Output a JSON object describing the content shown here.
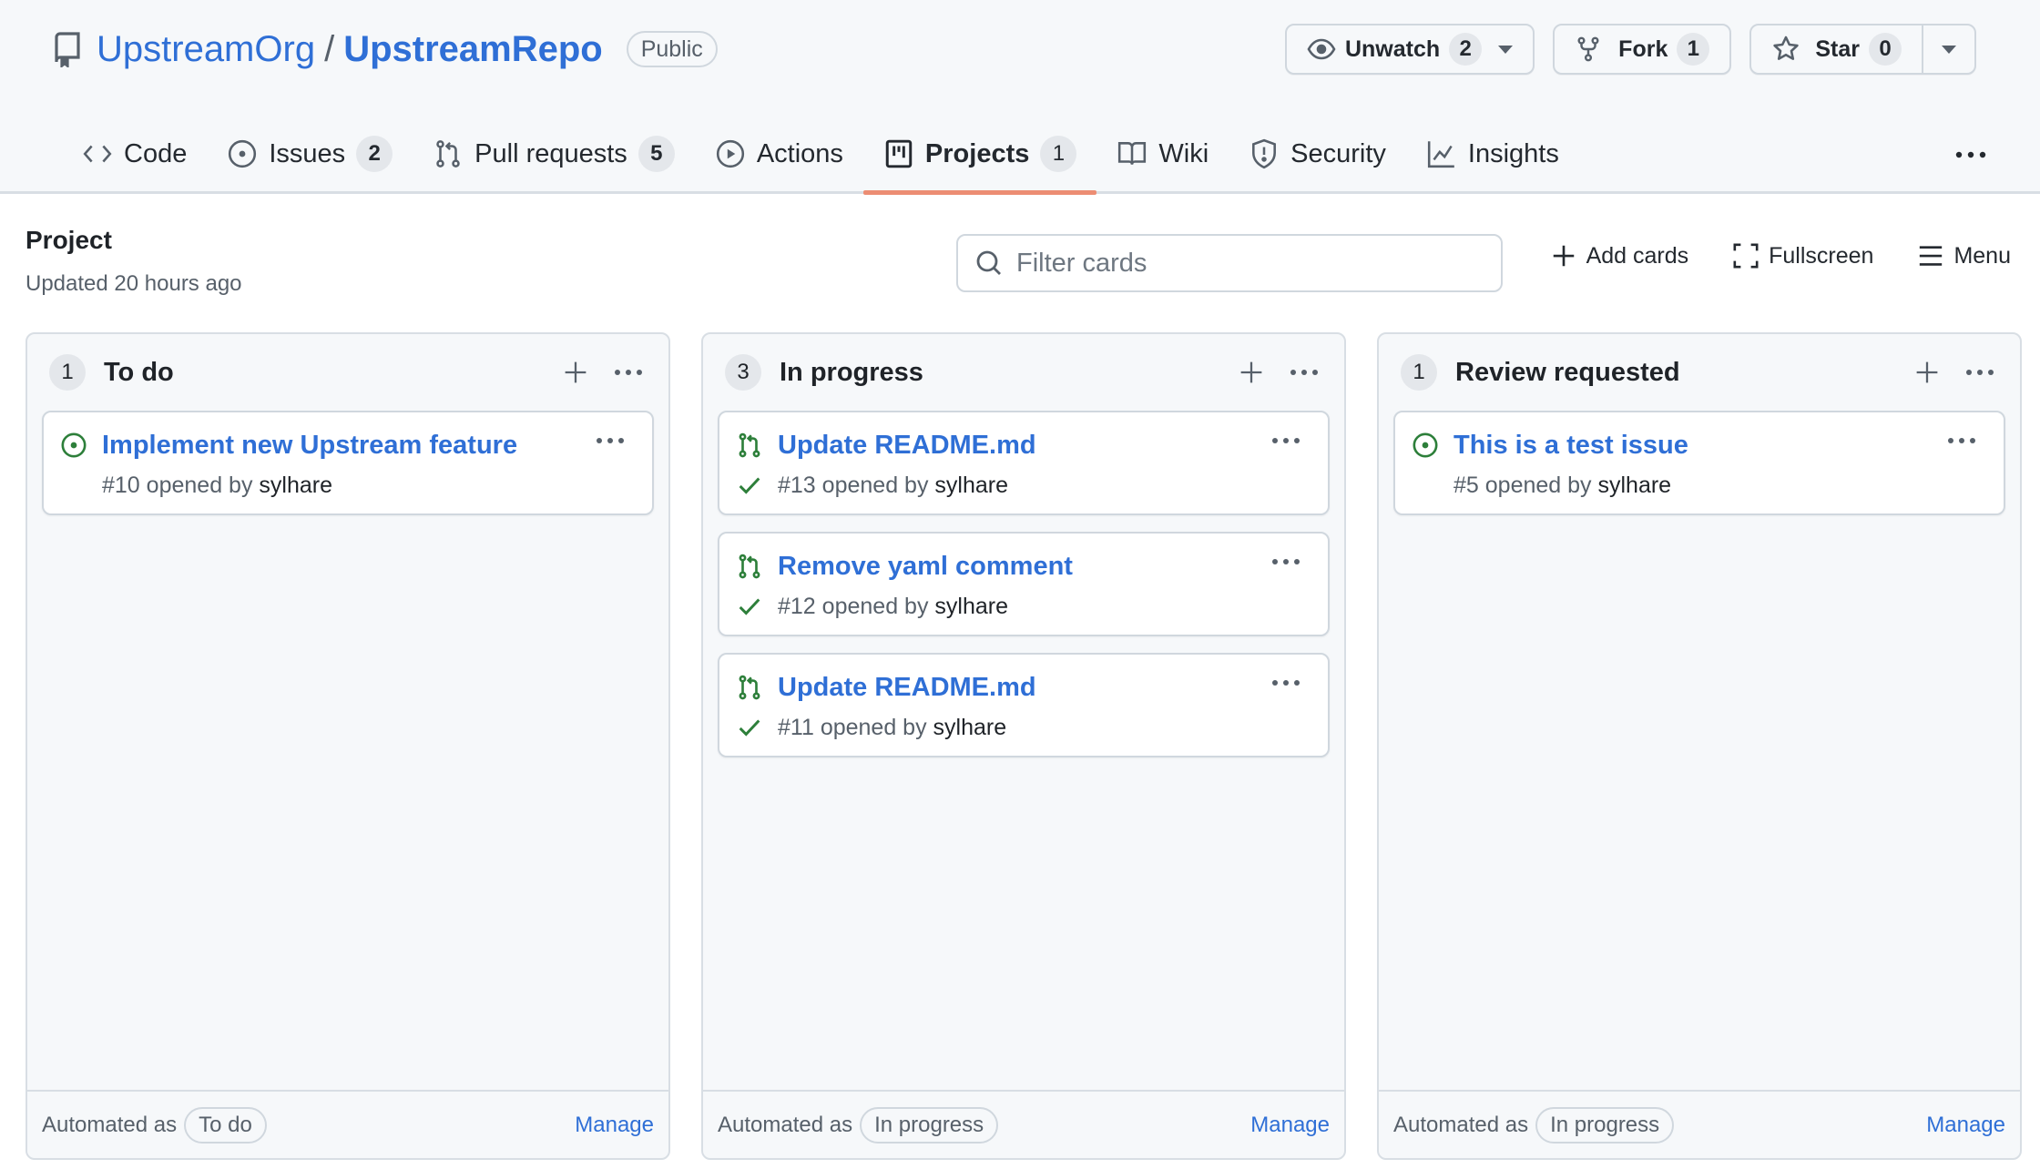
{
  "repo": {
    "owner": "UpstreamOrg",
    "separator": "/",
    "name": "UpstreamRepo",
    "visibility": "Public",
    "icon": "repo-icon"
  },
  "header_actions": {
    "watch": {
      "label": "Unwatch",
      "count": "2",
      "icon": "eye-icon"
    },
    "fork": {
      "label": "Fork",
      "count": "1",
      "icon": "repo-forked-icon"
    },
    "star": {
      "label": "Star",
      "count": "0",
      "icon": "star-icon"
    }
  },
  "tabs": [
    {
      "label": "Code",
      "icon": "code-icon",
      "count": null,
      "selected": false
    },
    {
      "label": "Issues",
      "icon": "issue-opened-icon",
      "count": "2",
      "selected": false
    },
    {
      "label": "Pull requests",
      "icon": "git-pull-request-icon",
      "count": "5",
      "selected": false
    },
    {
      "label": "Actions",
      "icon": "play-icon",
      "count": null,
      "selected": false
    },
    {
      "label": "Projects",
      "icon": "project-icon",
      "count": "1",
      "selected": true
    },
    {
      "label": "Wiki",
      "icon": "book-icon",
      "count": null,
      "selected": false
    },
    {
      "label": "Security",
      "icon": "shield-icon",
      "count": null,
      "selected": false
    },
    {
      "label": "Insights",
      "icon": "graph-icon",
      "count": null,
      "selected": false
    }
  ],
  "project": {
    "name": "Project",
    "updated": "Updated 20 hours ago"
  },
  "toolbar": {
    "filter_placeholder": "Filter cards",
    "filter_value": "",
    "add_cards": "Add cards",
    "fullscreen": "Fullscreen",
    "menu": "Menu"
  },
  "columns": [
    {
      "count": "1",
      "title": "To do",
      "automated_label": "Automated as",
      "automated_value": "To do",
      "manage": "Manage",
      "cards": [
        {
          "type": "issue",
          "title": "Implement new Upstream feature",
          "number": "#10",
          "opened_by": "opened by",
          "author": "sylhare",
          "checks_passed": false
        }
      ]
    },
    {
      "count": "3",
      "title": "In progress",
      "automated_label": "Automated as",
      "automated_value": "In progress",
      "manage": "Manage",
      "cards": [
        {
          "type": "pull-request",
          "title": "Update README.md",
          "number": "#13",
          "opened_by": "opened by",
          "author": "sylhare",
          "checks_passed": true
        },
        {
          "type": "pull-request",
          "title": "Remove yaml comment",
          "number": "#12",
          "opened_by": "opened by",
          "author": "sylhare",
          "checks_passed": true
        },
        {
          "type": "pull-request",
          "title": "Update README.md",
          "number": "#11",
          "opened_by": "opened by",
          "author": "sylhare",
          "checks_passed": true
        }
      ]
    },
    {
      "count": "1",
      "title": "Review requested",
      "automated_label": "Automated as",
      "automated_value": "In progress",
      "manage": "Manage",
      "cards": [
        {
          "type": "issue",
          "title": "This is a test issue",
          "number": "#5",
          "opened_by": "opened by",
          "author": "sylhare",
          "checks_passed": false
        }
      ]
    }
  ],
  "colors": {
    "link": "#2f6fd6",
    "open_green": "#2d7f3a",
    "selected_tab_underline": "#ec8d73",
    "muted_text": "#57606a"
  }
}
